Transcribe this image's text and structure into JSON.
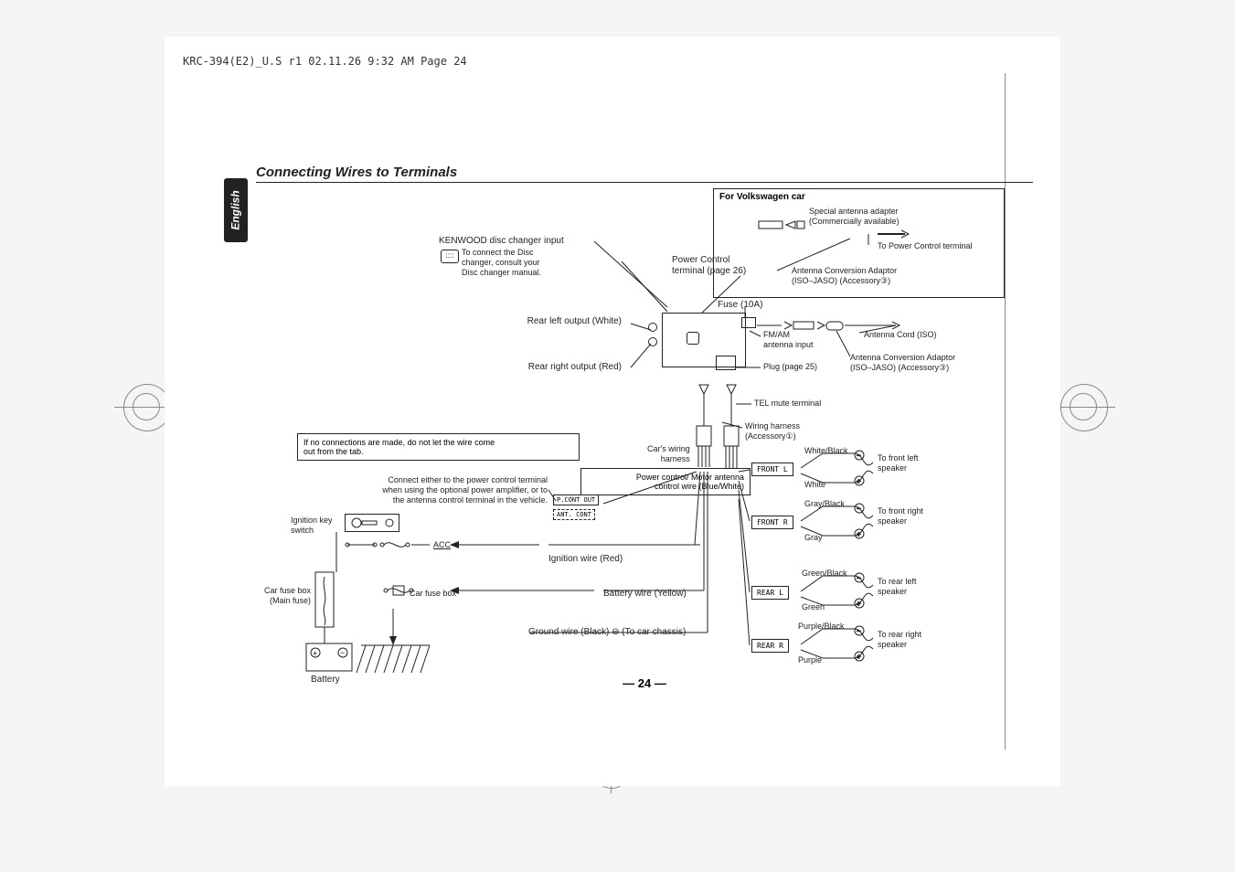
{
  "meta": {
    "header": "KRC-394(E2)_U.S r1  02.11.26  9:32 AM  Page 24"
  },
  "title": "Connecting Wires to Terminals",
  "language": "English",
  "page_number": "— 24 —",
  "vw_box_title": "For Volkswagen car",
  "labels": {
    "special_antenna": "Special antenna adapter\n(Commercially available)",
    "to_power_control": "To Power Control terminal",
    "antenna_conv_top": "Antenna Conversion Adaptor\n(ISO–JASO) (Accessory③)",
    "kenwood_input": "KENWOOD disc changer input",
    "disc_changer_note": "To connect the Disc\nchanger, consult your\nDisc changer manual.",
    "power_control": "Power Control\nterminal (page 26)",
    "fuse": "Fuse (10A)",
    "rear_left": "Rear left output (White)",
    "rear_right": "Rear right output (Red)",
    "fm_am": "FM/AM\nantenna input",
    "antenna_cord": "Antenna Cord (ISO)",
    "antenna_conv_bottom": "Antenna Conversion Adaptor\n(ISO–JASO) (Accessory③)",
    "plug": "Plug (page 25)",
    "tel_mute": "TEL mute terminal",
    "wiring_harness": "Wiring harness\n(Accessory①)",
    "cars_harness": "Car's wiring\nharness",
    "no_connections": "If no connections are made, do not let the wire come\nout from the tab.",
    "connect_either": "Connect either to the power control terminal\nwhen using the optional power amplifier, or to\nthe antenna control terminal in the vehicle.",
    "ignition_key": "Ignition key\nswitch",
    "acc": "ACC",
    "car_fuse_main": "Car fuse box\n(Main fuse)",
    "car_fuse": "Car fuse box",
    "ignition_wire": "Ignition wire (Red)",
    "battery_wire": "Battery wire (Yellow)",
    "power_motor": "Power control/ Motor antenna\ncontrol wire (Blue/White)",
    "ground_wire": "Ground wire (Black) ⊖ (To car chassis)",
    "battery": "Battery",
    "p_cont": "P.CONT OUT",
    "ant_cont": "ANT. CONT"
  },
  "speakers": [
    {
      "tag": "FRONT L",
      "neg": "White/Black",
      "pos": "White",
      "to": "To front left\nspeaker"
    },
    {
      "tag": "FRONT R",
      "neg": "Gray/Black",
      "pos": "Gray",
      "to": "To front right\nspeaker"
    },
    {
      "tag": "REAR L",
      "neg": "Green/Black",
      "pos": "Green",
      "to": "To rear left\nspeaker"
    },
    {
      "tag": "REAR R",
      "neg": "Purple/Black",
      "pos": "Purple",
      "to": "To rear right\nspeaker"
    }
  ]
}
